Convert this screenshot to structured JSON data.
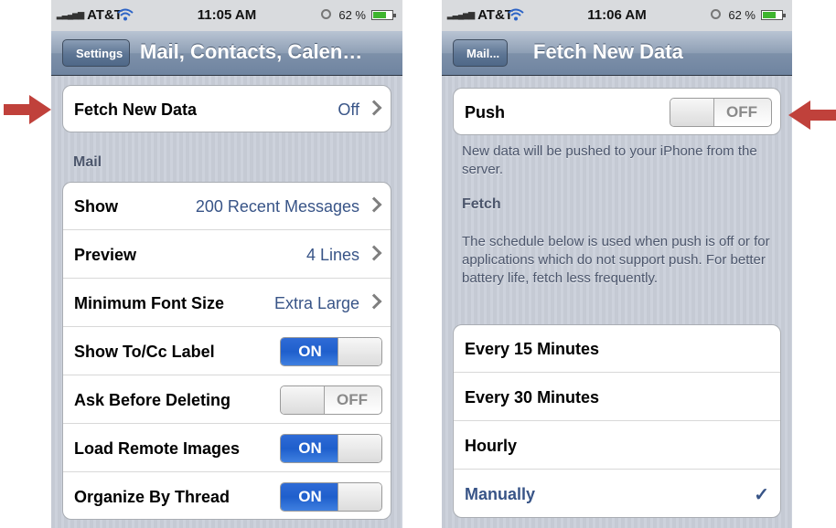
{
  "left": {
    "status": {
      "carrier": "AT&T",
      "time": "11:05 AM",
      "battery": "62 %"
    },
    "nav": {
      "back": "Settings",
      "title": "Mail, Contacts, Calen…"
    },
    "fetch_row": {
      "label": "Fetch New Data",
      "value": "Off"
    },
    "section": "Mail",
    "rows": [
      {
        "label": "Show",
        "value": "200 Recent Messages"
      },
      {
        "label": "Preview",
        "value": "4 Lines"
      },
      {
        "label": "Minimum Font Size",
        "value": "Extra Large"
      },
      {
        "label": "Show To/Cc Label",
        "toggle": "ON"
      },
      {
        "label": "Ask Before Deleting",
        "toggle": "OFF"
      },
      {
        "label": "Load Remote Images",
        "toggle": "ON"
      },
      {
        "label": "Organize By Thread",
        "toggle": "ON"
      }
    ]
  },
  "right": {
    "status": {
      "carrier": "AT&T",
      "time": "11:06 AM",
      "battery": "62 %"
    },
    "nav": {
      "back": "Mail...",
      "title": "Fetch New Data"
    },
    "push": {
      "label": "Push",
      "toggle": "OFF"
    },
    "push_footer": "New data will be pushed to your iPhone from the server.",
    "fetch_header": "Fetch",
    "fetch_footer": "The schedule below is used when push is off or for applications which do not support push. For better battery life, fetch less frequently.",
    "options": [
      {
        "label": "Every 15 Minutes"
      },
      {
        "label": "Every 30 Minutes"
      },
      {
        "label": "Hourly"
      },
      {
        "label": "Manually",
        "selected": true
      }
    ]
  },
  "colors": {
    "arrow": "#c0413b",
    "accent": "#385487",
    "toggle_on": "#2f6bd6"
  },
  "icons": [
    "wifi-icon",
    "lock-rotation-icon",
    "battery-icon",
    "chevron-right-icon",
    "checkmark-icon",
    "red-arrow-icon"
  ]
}
